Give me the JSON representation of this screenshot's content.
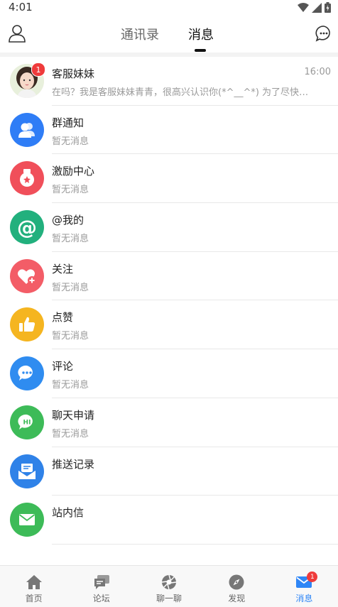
{
  "status": {
    "time": "4:01"
  },
  "header": {
    "tabs": [
      {
        "label": "通讯录",
        "active": false
      },
      {
        "label": "消息",
        "active": true
      }
    ]
  },
  "messages": [
    {
      "title": "客服妹妹",
      "subtitle": "在吗？我是客服妹妹青青，很高兴认识你(*^__^*) 为了尽快让你…",
      "time": "16:00",
      "badge": "1",
      "icon": "customer-service-avatar",
      "color": "#f3d8cf"
    },
    {
      "title": "群通知",
      "subtitle": "暂无消息",
      "icon": "group-icon",
      "color": "#2f7df6"
    },
    {
      "title": "激励中心",
      "subtitle": "暂无消息",
      "icon": "medal-icon",
      "color": "#f04f5a"
    },
    {
      "title": "@我的",
      "subtitle": "暂无消息",
      "icon": "at-icon",
      "color": "#22b07d"
    },
    {
      "title": "关注",
      "subtitle": "暂无消息",
      "icon": "heart-plus-icon",
      "color": "#f35d67"
    },
    {
      "title": "点赞",
      "subtitle": "暂无消息",
      "icon": "thumbs-up-icon",
      "color": "#f5b520"
    },
    {
      "title": "评论",
      "subtitle": "暂无消息",
      "icon": "comment-icon",
      "color": "#2f8cf0"
    },
    {
      "title": "聊天申请",
      "subtitle": "暂无消息",
      "icon": "hi-bubble-icon",
      "color": "#3dbb58"
    },
    {
      "title": "推送记录",
      "subtitle": "",
      "icon": "push-record-icon",
      "color": "#2f82e8"
    },
    {
      "title": "站内信",
      "subtitle": "",
      "icon": "mail-icon",
      "color": "#3dbb58"
    }
  ],
  "bottom_nav": [
    {
      "label": "首页",
      "icon": "home-icon",
      "active": false
    },
    {
      "label": "论坛",
      "icon": "forum-icon",
      "active": false
    },
    {
      "label": "聊一聊",
      "icon": "chat-aperture-icon",
      "active": false
    },
    {
      "label": "发现",
      "icon": "compass-icon",
      "active": false
    },
    {
      "label": "消息",
      "icon": "message-mail-icon",
      "active": true,
      "badge": "1"
    }
  ],
  "colors": {
    "accent": "#2f86f6",
    "badge": "#ef3b3b"
  }
}
